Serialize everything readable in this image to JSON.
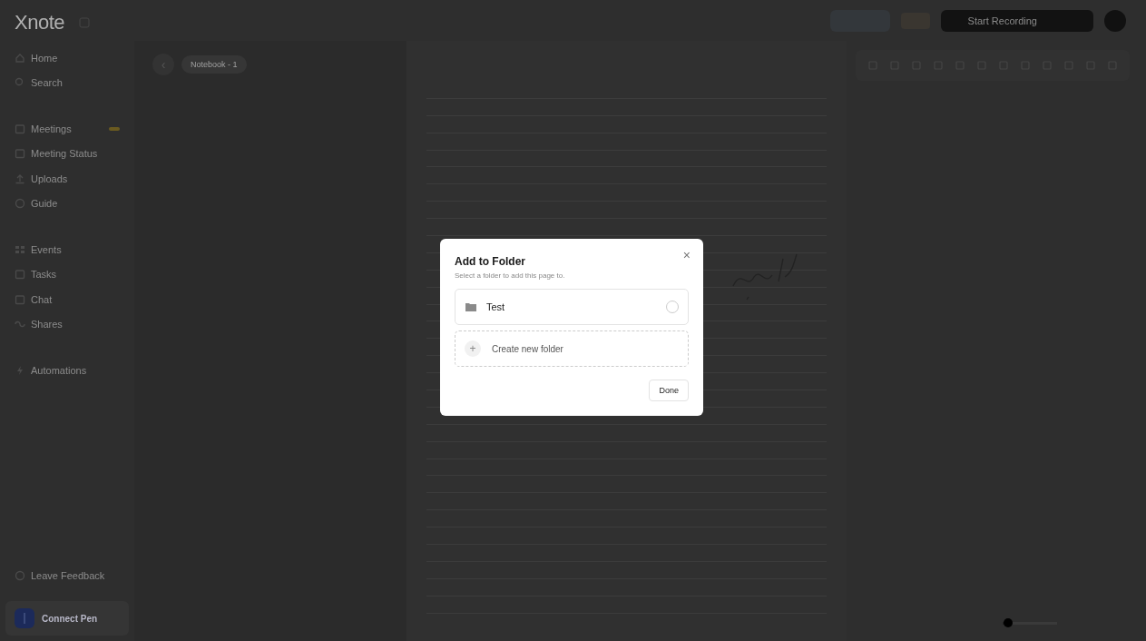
{
  "sidebar": {
    "logo": "Xnote",
    "nav": [
      {
        "label": "Home"
      },
      {
        "label": "Search"
      }
    ],
    "groups": [
      {
        "items": [
          {
            "label": "Meetings",
            "badge": true
          },
          {
            "label": "Meeting Status",
            "badge": false
          },
          {
            "label": "Uploads",
            "badge": false
          },
          {
            "label": "Guide",
            "badge": false
          }
        ]
      },
      {
        "items": [
          {
            "label": "Events",
            "badge": false
          },
          {
            "label": "Tasks",
            "badge": false
          },
          {
            "label": "Chat",
            "badge": false
          },
          {
            "label": "Shares",
            "badge": false
          }
        ]
      },
      {
        "items": [
          {
            "label": "Automations",
            "badge": false
          }
        ]
      }
    ],
    "feedback": "Leave Feedback",
    "pen": {
      "title": "Connect Pen"
    }
  },
  "topbar": {
    "record_button": "Start Recording"
  },
  "breadcrumb": {
    "back": "‹",
    "notebook": "Notebook - 1"
  },
  "zoom": {
    "level": 0.1
  },
  "modal": {
    "title": "Add to Folder",
    "subtitle": "Select a folder to add this page to.",
    "folders": [
      {
        "name": "Test",
        "selected": false
      }
    ],
    "create": "Create new folder",
    "plus": "+",
    "close": "×",
    "done": "Done"
  }
}
